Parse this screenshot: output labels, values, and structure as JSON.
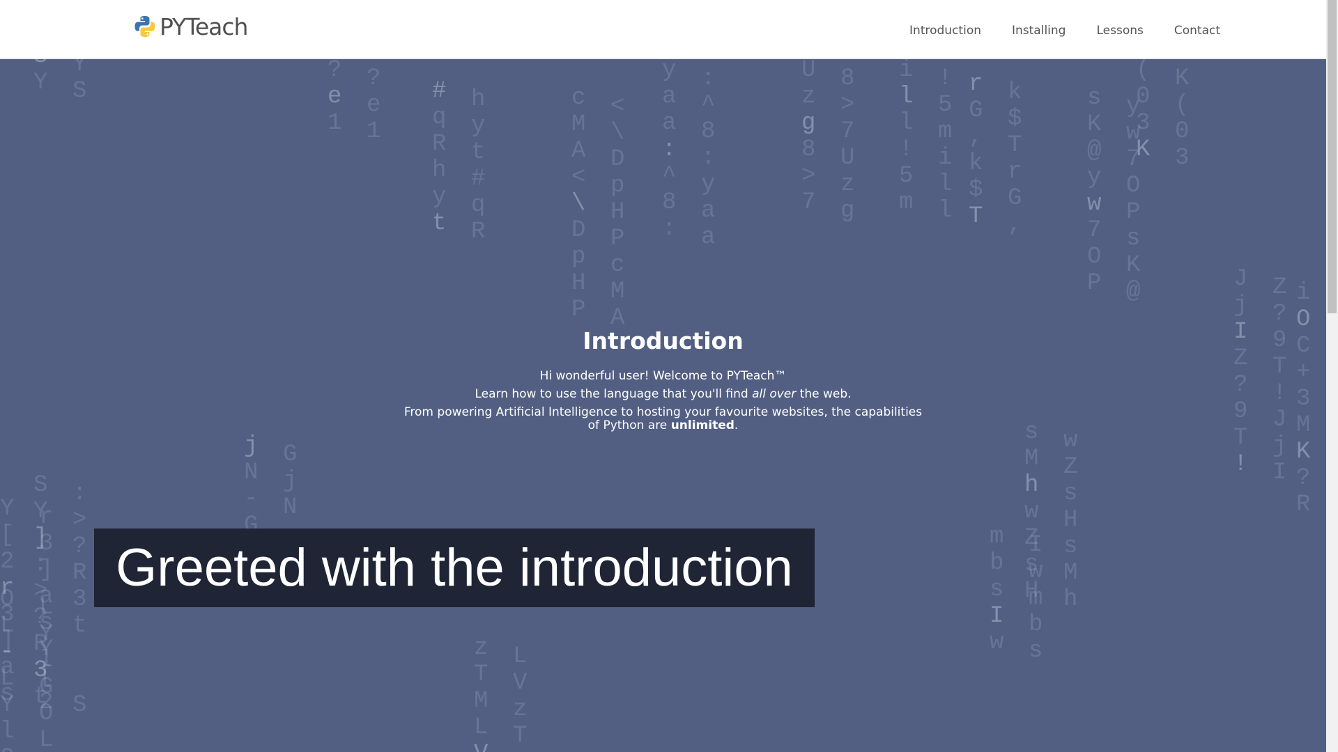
{
  "brand": {
    "name": "PYTeach",
    "logo_icon": "python-logo-icon"
  },
  "nav": {
    "items": [
      {
        "label": "Introduction"
      },
      {
        "label": "Installing"
      },
      {
        "label": "Lessons"
      },
      {
        "label": "Contact"
      }
    ]
  },
  "intro": {
    "title": "Introduction",
    "line1": "Hi wonderful user! Welcome to PYTeach™",
    "line2_before": "Learn how to use the language that you'll find ",
    "line2_em": "all over",
    "line2_after": " the web.",
    "line3_before": "From powering Artificial Intelligence to hosting your favourite websites, the capabilities of Python are ",
    "line3_strong": "unlimited",
    "line3_after": "."
  },
  "caption": {
    "text": "Greeted with the introduction"
  },
  "colors": {
    "background": "#525f82",
    "navbar": "#ffffff",
    "caption_bg": "#1f2535",
    "text_light": "#ffffff"
  },
  "matrix": {
    "columns": [
      "SY",
      "  SY]:>?R3t",
      "Y[2r3]as",
      "OL-LYlG",
      "?e1",
      "#qRhyt",
      "cMA<\\DpHP",
      "yaa:^8:",
      "Uzg8>7",
      "ill!5m",
      "rG,k$T",
      "sK@yw7OP",
      "(03K",
      "JjIZ?9T!",
      "iOC+3MK?R",
      "jN-G",
      "zTMLV",
      "mbsIw",
      "sMhwZsH"
    ]
  }
}
